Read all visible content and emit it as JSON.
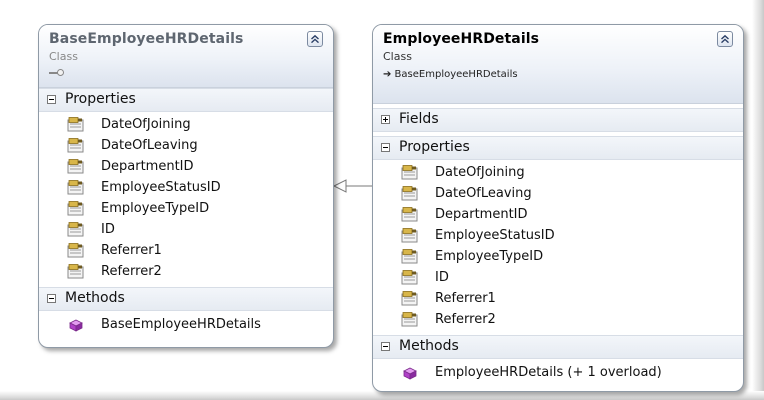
{
  "classes": {
    "base": {
      "name": "BaseEmployeeHRDetails",
      "kind": "Class",
      "properties_label": "Properties",
      "properties": [
        "DateOfJoining",
        "DateOfLeaving",
        "DepartmentID",
        "EmployeeStatusID",
        "EmployeeTypeID",
        "ID",
        "Referrer1",
        "Referrer2"
      ],
      "methods_label": "Methods",
      "methods": [
        "BaseEmployeeHRDetails"
      ]
    },
    "derived": {
      "name": "EmployeeHRDetails",
      "kind": "Class",
      "inherits": "➔ BaseEmployeeHRDetails",
      "fields_label": "Fields",
      "properties_label": "Properties",
      "properties": [
        "DateOfJoining",
        "DateOfLeaving",
        "DepartmentID",
        "EmployeeStatusID",
        "EmployeeTypeID",
        "ID",
        "Referrer1",
        "Referrer2"
      ],
      "methods_label": "Methods",
      "methods": [
        "EmployeeHRDetails (+ 1 overload)"
      ]
    }
  },
  "icons": {
    "property": "property-icon",
    "method": "method-icon",
    "collapse": "double-chevron-up-icon",
    "expand": "plus-icon",
    "collapse_section": "minus-icon"
  },
  "colors": {
    "method_icon": "#b040c8",
    "property_icon": "#d8b64a",
    "border": "#8f9aa6"
  }
}
